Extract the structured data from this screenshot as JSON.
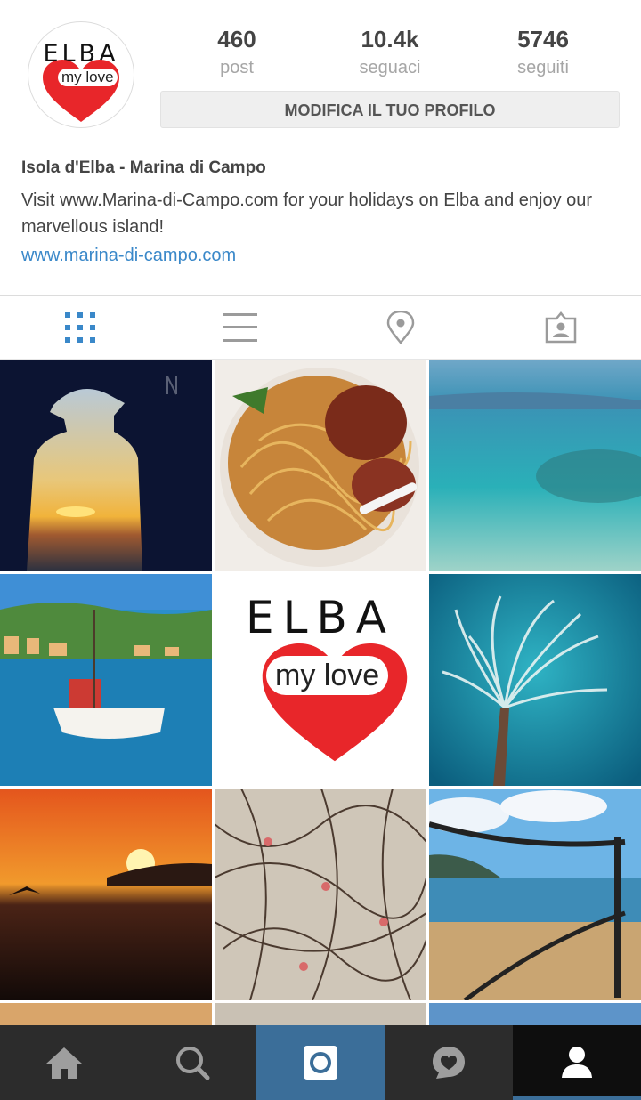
{
  "profile": {
    "avatar": {
      "title": "ELBA",
      "subtitle": "my love",
      "heart_color": "#e8262a"
    },
    "stats": [
      {
        "value": "460",
        "label": "post"
      },
      {
        "value": "10.4k",
        "label": "seguaci"
      },
      {
        "value": "5746",
        "label": "seguiti"
      }
    ],
    "edit_button": "MODIFICA IL TUO PROFILO",
    "name": "Isola d'Elba - Marina di Campo",
    "bio": "Visit www.Marina-di-Campo.com for your holidays on Elba and enjoy our marvellous island!",
    "website": "www.marina-di-campo.com"
  },
  "tabs": [
    {
      "icon": "grid-icon",
      "active": true
    },
    {
      "icon": "list-icon",
      "active": false
    },
    {
      "icon": "location-pin-icon",
      "active": false
    },
    {
      "icon": "tagged-photos-icon",
      "active": false
    }
  ],
  "grid_logo": {
    "title": "ELBA",
    "subtitle": "my love"
  },
  "photos": [
    "silhouette-sunset",
    "spaghetti-octopus",
    "turquoise-sea",
    "harbour-boat",
    "elba-my-love-logo",
    "tube-worm",
    "orange-sunset",
    "fishing-nets",
    "beach-rope-fence"
  ],
  "bottom_nav": [
    {
      "icon": "home-icon",
      "active": false
    },
    {
      "icon": "search-icon",
      "active": false
    },
    {
      "icon": "camera-icon",
      "active": false
    },
    {
      "icon": "activity-heart-icon",
      "active": false
    },
    {
      "icon": "profile-icon",
      "active": true
    }
  ],
  "colors": {
    "accent": "#3a88c9",
    "nav_bg": "#2c2c2c",
    "camera_bg": "#3b6e99",
    "active_nav": "#0e0e0e"
  }
}
